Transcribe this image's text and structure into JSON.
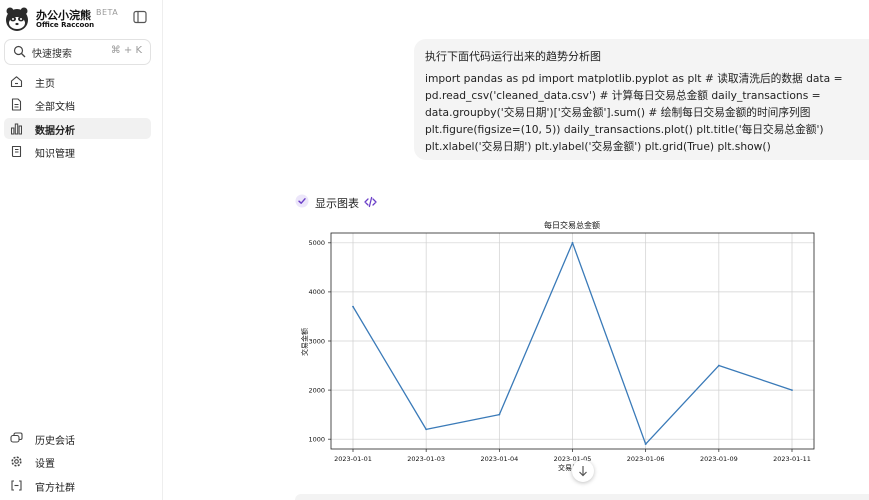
{
  "brand": {
    "name": "办公小浣熊",
    "badge": "BETA",
    "subtitle": "Office Raccoon"
  },
  "search": {
    "label": "快速搜索",
    "shortcut": "⌘ + K",
    "icon": "search-icon"
  },
  "nav": {
    "top": [
      {
        "label": "主页",
        "icon": "home-icon"
      },
      {
        "label": "全部文档",
        "icon": "document-icon"
      },
      {
        "label": "数据分析",
        "icon": "bar-chart-icon",
        "active": true
      },
      {
        "label": "知识管理",
        "icon": "book-icon"
      }
    ],
    "bottom": [
      {
        "label": "历史会话",
        "icon": "chat-history-icon"
      },
      {
        "label": "设置",
        "icon": "gear-icon"
      },
      {
        "label": "官方社群",
        "icon": "community-icon"
      }
    ]
  },
  "message": {
    "title": "执行下面代码运行出来的趋势分析图",
    "code": "import pandas as pd import matplotlib.pyplot as plt # 读取清洗后的数据 data = pd.read_csv('cleaned_data.csv') # 计算每日交易总金额 daily_transactions = data.groupby('交易日期')['交易金额'].sum() # 绘制每日交易金额的时间序列图 plt.figure(figsize=(10, 5)) daily_transactions.plot() plt.title('每日交易总金额') plt.xlabel('交易日期') plt.ylabel('交易金额') plt.grid(True) plt.show()"
  },
  "tool": {
    "label": "显示图表",
    "status_icon": "check-icon",
    "code_icon": "code-icon"
  },
  "colors": {
    "line": "#3a7ab8",
    "active_nav": "#f1f1f1",
    "check": "#6b3fc8"
  },
  "chart_data": {
    "type": "line",
    "title": "每日交易总金额",
    "xlabel": "交易日期",
    "ylabel": "交易金额",
    "categories": [
      "2023-01-01",
      "2023-01-03",
      "2023-01-04",
      "2023-01-05",
      "2023-01-06",
      "2023-01-09",
      "2023-01-11"
    ],
    "series": [
      {
        "values": [
          3700,
          1200,
          1500,
          5000,
          900,
          2500,
          2000
        ]
      }
    ],
    "yticks": [
      1000,
      2000,
      3000,
      4000,
      5000
    ],
    "ylim": [
      800,
      5200
    ],
    "grid": true
  }
}
